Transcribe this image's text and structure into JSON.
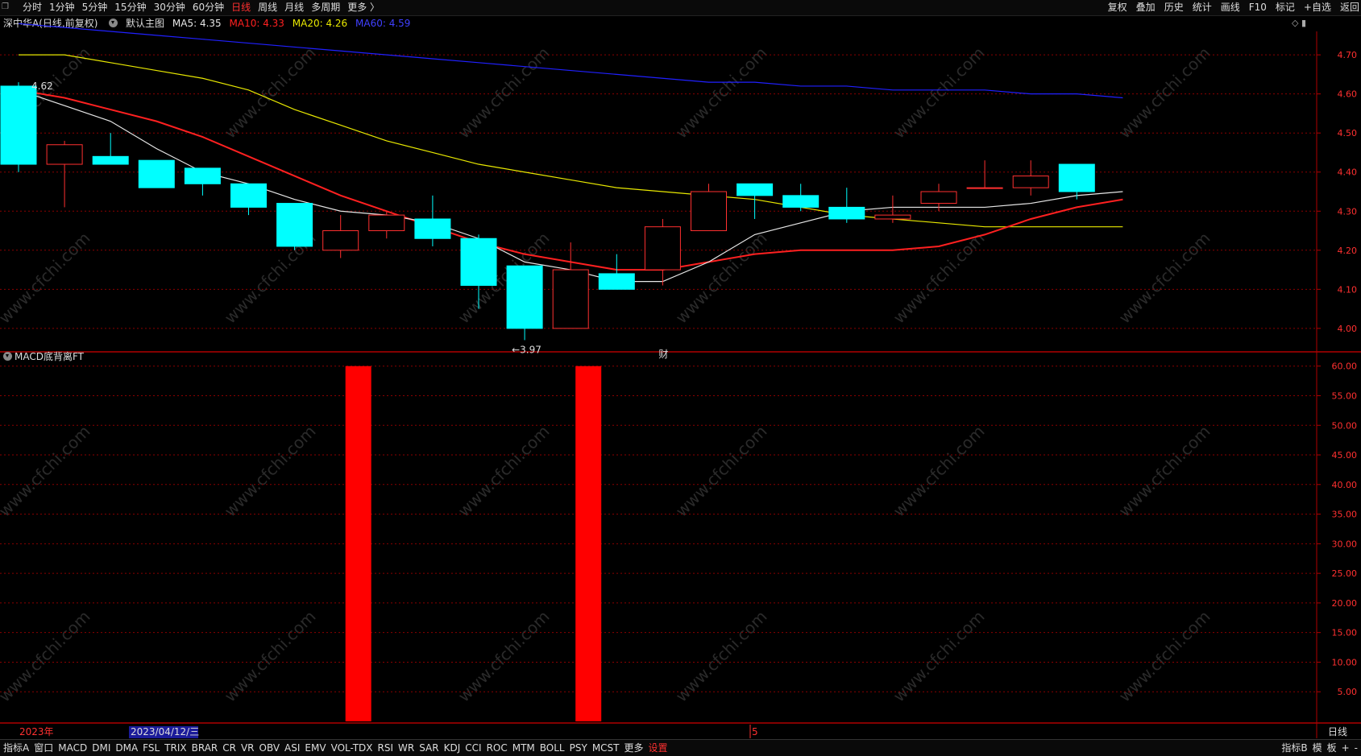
{
  "topbar": {
    "period_tabs": [
      {
        "label": "分时",
        "active": false
      },
      {
        "label": "1分钟",
        "active": false
      },
      {
        "label": "5分钟",
        "active": false
      },
      {
        "label": "15分钟",
        "active": false
      },
      {
        "label": "30分钟",
        "active": false
      },
      {
        "label": "60分钟",
        "active": false
      },
      {
        "label": "日线",
        "active": true
      },
      {
        "label": "周线",
        "active": false
      },
      {
        "label": "月线",
        "active": false
      },
      {
        "label": "多周期",
        "active": false
      },
      {
        "label": "更多 〉",
        "active": false
      }
    ],
    "right_tools": [
      "复权",
      "叠加",
      "历史",
      "统计",
      "画线",
      "F10",
      "标记",
      "+自选",
      "返回"
    ]
  },
  "infobar": {
    "stock_name": "深中华A(日线,前复权)",
    "main_chart_label": "默认主图",
    "ma5": "MA5: 4.35",
    "ma10": "MA10: 4.33",
    "ma20": "MA20: 4.26",
    "ma60": "MA60: 4.59"
  },
  "colors": {
    "up": "#ff3030",
    "down": "#00ffff",
    "ma5": "#e6e6e6",
    "ma10": "#ff2020",
    "ma20": "#e8e800",
    "ma60": "#2020ff",
    "grid": "#8b0000"
  },
  "chart_data": [
    {
      "type": "candlestick",
      "ylim": [
        3.94,
        4.76
      ],
      "y_ticks": [
        "4.70",
        "4.60",
        "4.50",
        "4.40",
        "4.30",
        "4.20",
        "4.10",
        "4.00"
      ],
      "candles": [
        {
          "o": 4.62,
          "h": 4.63,
          "l": 4.4,
          "c": 4.42
        },
        {
          "o": 4.42,
          "h": 4.48,
          "l": 4.31,
          "c": 4.47
        },
        {
          "o": 4.44,
          "h": 4.5,
          "l": 4.42,
          "c": 4.42
        },
        {
          "o": 4.43,
          "h": 4.43,
          "l": 4.36,
          "c": 4.36
        },
        {
          "o": 4.41,
          "h": 4.41,
          "l": 4.34,
          "c": 4.37
        },
        {
          "o": 4.37,
          "h": 4.37,
          "l": 4.29,
          "c": 4.31
        },
        {
          "o": 4.32,
          "h": 4.32,
          "l": 4.2,
          "c": 4.21
        },
        {
          "o": 4.2,
          "h": 4.29,
          "l": 4.18,
          "c": 4.25
        },
        {
          "o": 4.25,
          "h": 4.3,
          "l": 4.23,
          "c": 4.29
        },
        {
          "o": 4.28,
          "h": 4.34,
          "l": 4.21,
          "c": 4.23
        },
        {
          "o": 4.23,
          "h": 4.24,
          "l": 4.05,
          "c": 4.11
        },
        {
          "o": 4.16,
          "h": 4.16,
          "l": 3.97,
          "c": 4.0
        },
        {
          "o": 4.0,
          "h": 4.22,
          "l": 4.0,
          "c": 4.15
        },
        {
          "o": 4.14,
          "h": 4.19,
          "l": 4.1,
          "c": 4.1
        },
        {
          "o": 4.15,
          "h": 4.28,
          "l": 4.11,
          "c": 4.26
        },
        {
          "o": 4.25,
          "h": 4.37,
          "l": 4.25,
          "c": 4.35
        },
        {
          "o": 4.37,
          "h": 4.37,
          "l": 4.28,
          "c": 4.34
        },
        {
          "o": 4.34,
          "h": 4.37,
          "l": 4.3,
          "c": 4.31
        },
        {
          "o": 4.31,
          "h": 4.36,
          "l": 4.27,
          "c": 4.28
        },
        {
          "o": 4.28,
          "h": 4.34,
          "l": 4.27,
          "c": 4.29
        },
        {
          "o": 4.32,
          "h": 4.37,
          "l": 4.3,
          "c": 4.35
        },
        {
          "o": 4.36,
          "h": 4.43,
          "l": 4.36,
          "c": 4.36
        },
        {
          "o": 4.36,
          "h": 4.43,
          "l": 4.34,
          "c": 4.39
        },
        {
          "o": 4.42,
          "h": 4.42,
          "l": 4.33,
          "c": 4.35
        }
      ],
      "ma5": [
        4.61,
        4.57,
        4.53,
        4.46,
        4.4,
        4.37,
        4.33,
        4.3,
        4.29,
        4.27,
        4.23,
        4.17,
        4.15,
        4.12,
        4.12,
        4.17,
        4.24,
        4.27,
        4.3,
        4.31,
        4.31,
        4.31,
        4.32,
        4.34,
        4.35
      ],
      "ma10": [
        4.61,
        4.59,
        4.56,
        4.53,
        4.49,
        4.44,
        4.39,
        4.34,
        4.3,
        4.26,
        4.22,
        4.19,
        4.17,
        4.15,
        4.15,
        4.17,
        4.19,
        4.2,
        4.2,
        4.2,
        4.21,
        4.24,
        4.28,
        4.31,
        4.33
      ],
      "ma20": [
        4.7,
        4.7,
        4.68,
        4.66,
        4.64,
        4.61,
        4.56,
        4.52,
        4.48,
        4.45,
        4.42,
        4.4,
        4.38,
        4.36,
        4.35,
        4.34,
        4.33,
        4.31,
        4.29,
        4.28,
        4.27,
        4.26,
        4.26,
        4.26,
        4.26
      ],
      "ma60": [
        4.78,
        4.77,
        4.76,
        4.75,
        4.74,
        4.73,
        4.72,
        4.71,
        4.7,
        4.69,
        4.68,
        4.67,
        4.66,
        4.65,
        4.64,
        4.63,
        4.63,
        4.62,
        4.62,
        4.61,
        4.61,
        4.61,
        4.6,
        4.6,
        4.59
      ],
      "annotations": [
        {
          "label": "4.62",
          "candle": 0,
          "price": 4.62
        },
        {
          "label": "←3.97",
          "candle": 11,
          "price": 3.97
        },
        {
          "label": "财",
          "candle": 14,
          "price": 3.94
        }
      ]
    },
    {
      "type": "bar",
      "title": "MACD底背离FT",
      "ylim": [
        0,
        62
      ],
      "y_ticks": [
        "60.00",
        "55.00",
        "50.00",
        "45.00",
        "40.00",
        "35.00",
        "30.00",
        "25.00",
        "20.00",
        "15.00",
        "10.00",
        "5.00"
      ],
      "bars": [
        {
          "candle": 7,
          "value": 60
        },
        {
          "candle": 12,
          "value": 60
        }
      ]
    }
  ],
  "date_axis": {
    "year_label": "2023年",
    "cursor_date": "2023/04/12/三",
    "month_label": "5",
    "period_label": "日线"
  },
  "bottombar": {
    "indicators": [
      {
        "label": "指标A",
        "red": false
      },
      {
        "label": "窗口",
        "red": false
      },
      {
        "label": "MACD",
        "red": false
      },
      {
        "label": "DMI",
        "red": false
      },
      {
        "label": "DMA",
        "red": false
      },
      {
        "label": "FSL",
        "red": false
      },
      {
        "label": "TRIX",
        "red": false
      },
      {
        "label": "BRAR",
        "red": false
      },
      {
        "label": "CR",
        "red": false
      },
      {
        "label": "VR",
        "red": false
      },
      {
        "label": "OBV",
        "red": false
      },
      {
        "label": "ASI",
        "red": false
      },
      {
        "label": "EMV",
        "red": false
      },
      {
        "label": "VOL-TDX",
        "red": false
      },
      {
        "label": "RSI",
        "red": false
      },
      {
        "label": "WR",
        "red": false
      },
      {
        "label": "SAR",
        "red": false
      },
      {
        "label": "KDJ",
        "red": false
      },
      {
        "label": "CCI",
        "red": false
      },
      {
        "label": "ROC",
        "red": false
      },
      {
        "label": "MTM",
        "red": false
      },
      {
        "label": "BOLL",
        "red": false
      },
      {
        "label": "PSY",
        "red": false
      },
      {
        "label": "MCST",
        "red": false
      },
      {
        "label": "更多",
        "red": false
      },
      {
        "label": "设置",
        "red": true
      }
    ],
    "right_items": [
      "指标B",
      "模",
      "板",
      "+",
      "-"
    ]
  },
  "watermark": "www.cfchi.com"
}
